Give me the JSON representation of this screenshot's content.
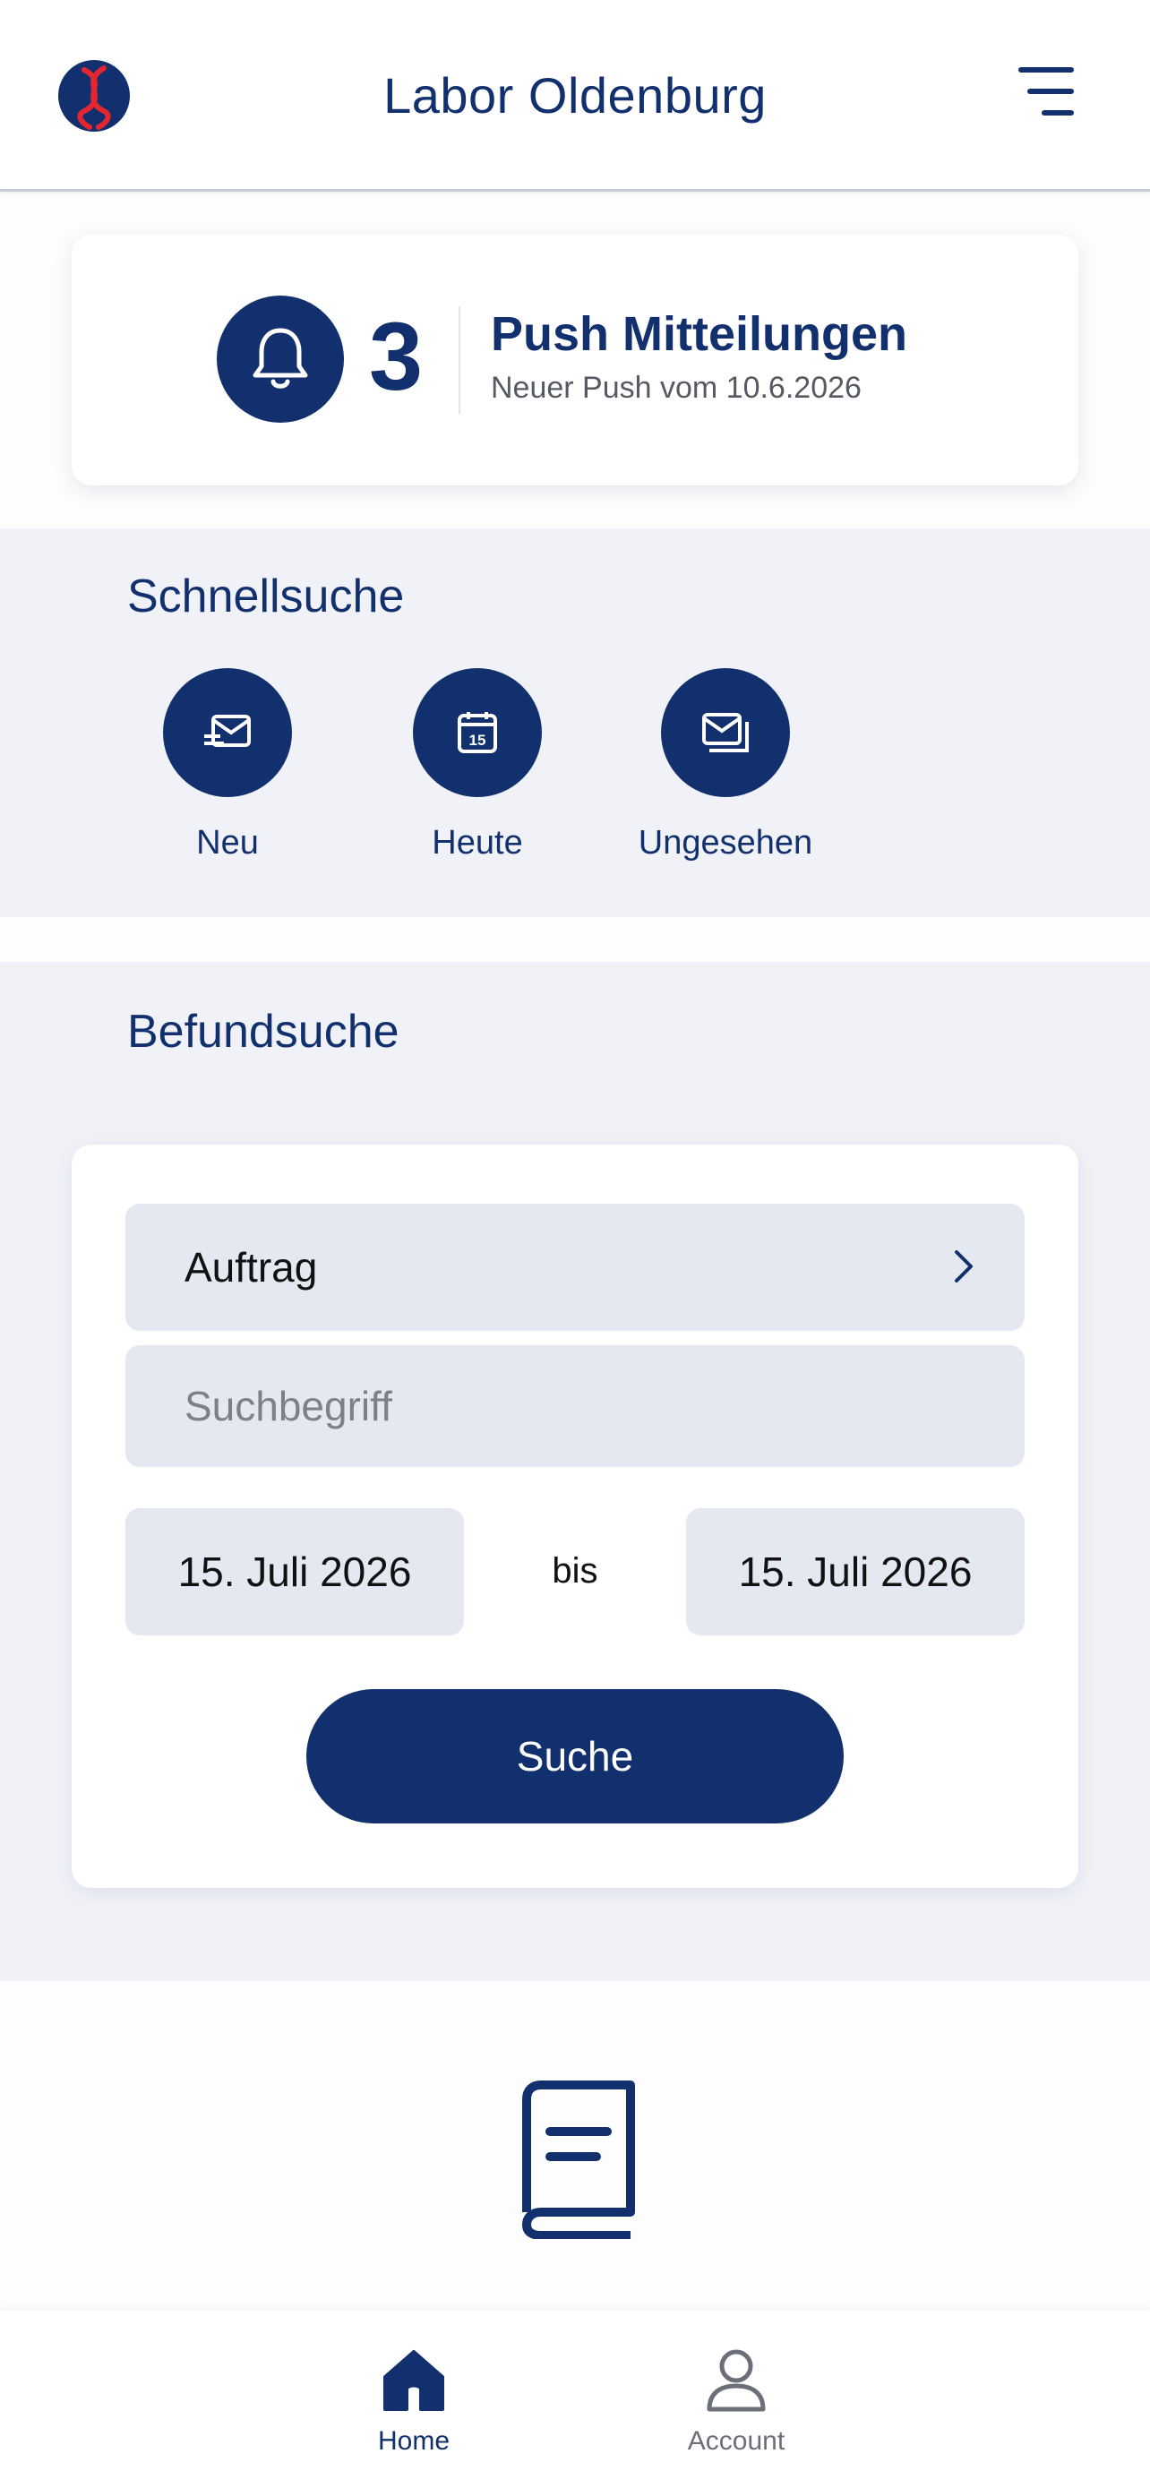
{
  "header": {
    "title": "Labor Oldenburg",
    "logo_icon": "dna-logo-icon",
    "menu_icon": "menu-icon"
  },
  "push": {
    "icon": "bell-icon",
    "count": "3",
    "title": "Push Mitteilungen",
    "subtitle": "Neuer Push vom 10.6.2026"
  },
  "quick_search": {
    "title": "Schnellsuche",
    "items": [
      {
        "label": "Neu",
        "icon": "new-mail-icon"
      },
      {
        "label": "Heute",
        "icon": "calendar-icon"
      },
      {
        "label": "Ungesehen",
        "icon": "unseen-mail-icon"
      }
    ]
  },
  "report_search": {
    "title": "Befundsuche",
    "order_select": {
      "value": "Auftrag"
    },
    "search_field": {
      "placeholder": "Suchbegriff"
    },
    "date_from": "15. Juli 2026",
    "separator": "bis",
    "date_to": "15. Juli 2026",
    "button": "Suche"
  },
  "bottom_nav": {
    "items": [
      {
        "label": "Home",
        "icon": "home-icon",
        "active": true
      },
      {
        "label": "Account",
        "icon": "account-icon",
        "active": false
      }
    ]
  },
  "colors": {
    "primary": "#12306e",
    "section_bg": "#f0f2f7",
    "field_bg": "#e4e8f1",
    "logo_red": "#e3262f"
  }
}
